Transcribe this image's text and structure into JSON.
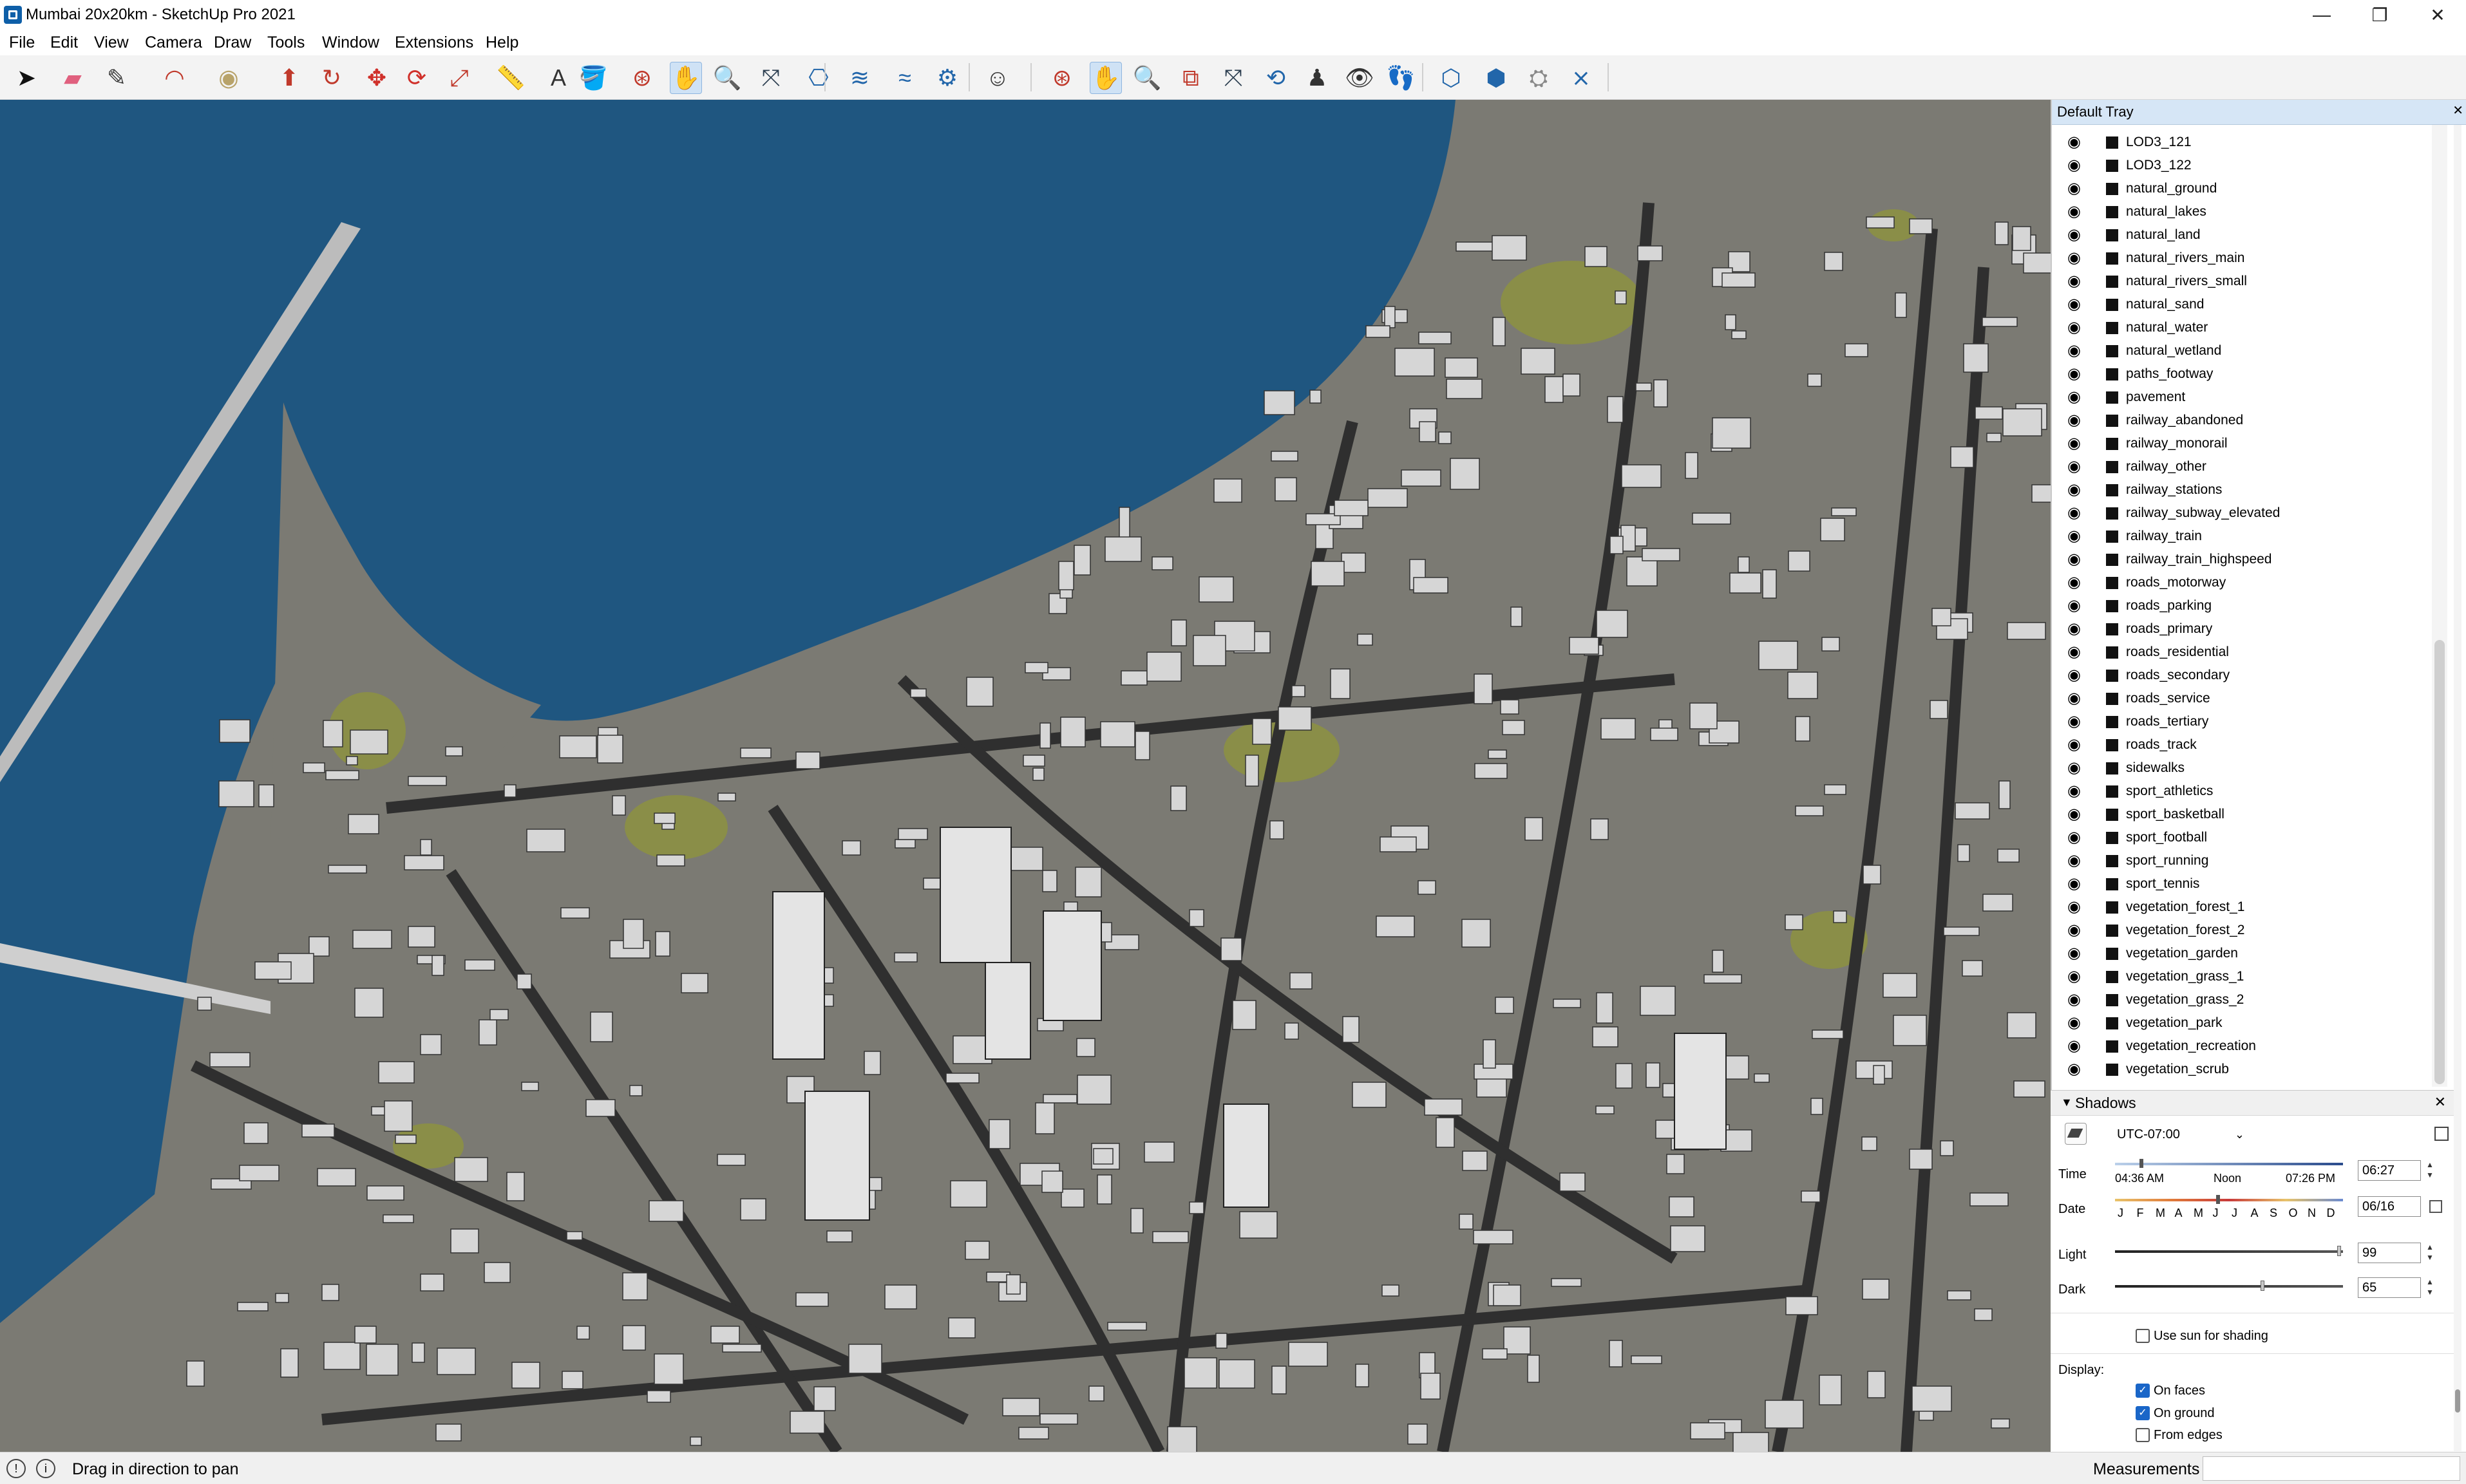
{
  "window": {
    "title": "Mumbai 20x20km - SketchUp Pro 2021",
    "minimize_glyph": "—",
    "maximize_glyph": "❐",
    "close_glyph": "✕"
  },
  "menu": [
    "File",
    "Edit",
    "View",
    "Camera",
    "Draw",
    "Tools",
    "Window",
    "Extensions",
    "Help"
  ],
  "toolbar": {
    "tools": [
      {
        "name": "select-tool-icon",
        "glyph": "➤",
        "color": "#111111"
      },
      {
        "name": "eraser-tool-icon",
        "glyph": "▰",
        "color": "#e0607e"
      },
      {
        "name": "pencil-line-tool-icon",
        "glyph": "✎",
        "color": "#3a3a3a"
      },
      {
        "name": "arc-tool-icon",
        "glyph": "◠",
        "color": "#c0392b"
      },
      {
        "name": "circle-shape-tool-icon",
        "glyph": "◉",
        "color": "#b8a36a"
      },
      {
        "name": "push-pull-tool-icon",
        "glyph": "⬆",
        "color": "#c0392b"
      },
      {
        "name": "follow-me-tool-icon",
        "glyph": "↻",
        "color": "#c0392b"
      },
      {
        "name": "move-tool-icon",
        "glyph": "✥",
        "color": "#d0302a"
      },
      {
        "name": "rotate-tool-icon",
        "glyph": "⟳",
        "color": "#d0302a"
      },
      {
        "name": "scale-tool-icon",
        "glyph": "⤢",
        "color": "#c0392b"
      },
      {
        "name": "tape-measure-tool-icon",
        "glyph": "📏",
        "color": "#c9a400"
      },
      {
        "name": "text-tool-icon",
        "glyph": "A",
        "color": "#333333"
      },
      {
        "name": "paint-bucket-tool-icon",
        "glyph": "🪣",
        "color": "#2e6fd1"
      },
      {
        "name": "orbit-tool-icon",
        "glyph": "⊛",
        "color": "#c0392b"
      },
      {
        "name": "pan-tool-icon",
        "glyph": "✋",
        "color": "#d4a94a"
      },
      {
        "name": "zoom-tool-icon",
        "glyph": "🔍",
        "color": "#2c3e50"
      },
      {
        "name": "zoom-extents-tool-icon",
        "glyph": "⤧",
        "color": "#2c3e50"
      },
      {
        "name": "sandbox-from-contours-icon",
        "glyph": "⎔",
        "color": "#2266aa"
      },
      {
        "name": "sandbox-from-scratch-icon",
        "glyph": "≋",
        "color": "#2266aa"
      },
      {
        "name": "sandbox-smoove-icon",
        "glyph": "≈",
        "color": "#2266aa"
      },
      {
        "name": "sandbox-stamp-icon",
        "glyph": "⚙",
        "color": "#2266aa"
      },
      {
        "name": "user-account-icon",
        "glyph": "☺",
        "color": "#333333"
      },
      {
        "name": "orbit-camera-icon",
        "glyph": "⊛",
        "color": "#c0392b"
      },
      {
        "name": "pan-camera-icon",
        "glyph": "✋",
        "color": "#d4a94a"
      },
      {
        "name": "zoom-camera-icon",
        "glyph": "🔍",
        "color": "#2c3e50"
      },
      {
        "name": "zoom-window-icon",
        "glyph": "⧉",
        "color": "#c0392b"
      },
      {
        "name": "zoom-extents-camera-icon",
        "glyph": "⤧",
        "color": "#2c3e50"
      },
      {
        "name": "previous-view-icon",
        "glyph": "⟲",
        "color": "#2266aa"
      },
      {
        "name": "position-camera-icon",
        "glyph": "♟",
        "color": "#333333"
      },
      {
        "name": "look-around-icon",
        "glyph": "👁",
        "color": "#333333"
      },
      {
        "name": "walk-icon",
        "glyph": "👣",
        "color": "#333333"
      },
      {
        "name": "section-plane-icon",
        "glyph": "⬡",
        "color": "#2266aa"
      },
      {
        "name": "display-section-planes-icon",
        "glyph": "⬢",
        "color": "#2266aa"
      },
      {
        "name": "extension-warehouse-icon",
        "glyph": "⛭",
        "color": "#888888"
      },
      {
        "name": "sandbox-flip-edge-icon",
        "glyph": "⨯",
        "color": "#2266aa"
      }
    ]
  },
  "viewport": {
    "colors": {
      "water": "#1f5680",
      "ground": "#7b7a73",
      "road": "#2f2f2f",
      "park": "#8a8e48",
      "building": "#d6d6d6"
    }
  },
  "tray": {
    "title": "Default Tray",
    "pin_glyph": "✕",
    "layers": [
      "LOD3_121",
      "LOD3_122",
      "natural_ground",
      "natural_lakes",
      "natural_land",
      "natural_rivers_main",
      "natural_rivers_small",
      "natural_sand",
      "natural_water",
      "natural_wetland",
      "paths_footway",
      "pavement",
      "railway_abandoned",
      "railway_monorail",
      "railway_other",
      "railway_stations",
      "railway_subway_elevated",
      "railway_train",
      "railway_train_highspeed",
      "roads_motorway",
      "roads_parking",
      "roads_primary",
      "roads_residential",
      "roads_secondary",
      "roads_service",
      "roads_tertiary",
      "roads_track",
      "sidewalks",
      "sport_athletics",
      "sport_basketball",
      "sport_football",
      "sport_running",
      "sport_tennis",
      "vegetation_forest_1",
      "vegetation_forest_2",
      "vegetation_garden",
      "vegetation_grass_1",
      "vegetation_grass_2",
      "vegetation_park",
      "vegetation_recreation",
      "vegetation_scrub"
    ],
    "eye_glyph": "◉"
  },
  "shadows": {
    "title": "Shadows",
    "timezone": "UTC-07:00",
    "time_label": "Time",
    "sunrise": "04:36 AM",
    "noon": "Noon",
    "sunset": "07:26 PM",
    "time_value": "06:27",
    "date_label": "Date",
    "months": [
      "J",
      "F",
      "M",
      "A",
      "M",
      "J",
      "J",
      "A",
      "S",
      "O",
      "N",
      "D"
    ],
    "date_value": "06/16",
    "light_label": "Light",
    "light_value": "99",
    "dark_label": "Dark",
    "dark_value": "65",
    "use_sun_label": "Use sun for shading",
    "display_label": "Display:",
    "on_faces_label": "On faces",
    "on_ground_label": "On ground",
    "from_edges_label": "From edges",
    "time_fraction": 0.11,
    "date_fraction": 0.45,
    "light_fraction": 0.99,
    "dark_fraction": 0.65
  },
  "status": {
    "text": "Drag in direction to pan",
    "measurements_label": "Measurements"
  }
}
